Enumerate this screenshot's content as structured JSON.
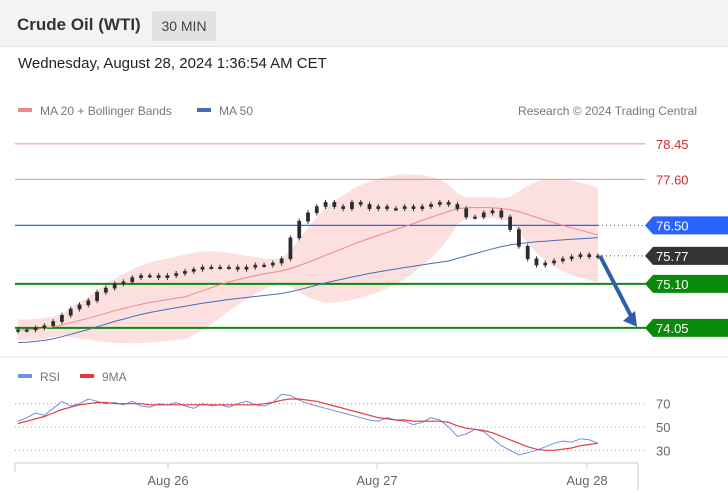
{
  "header": {
    "instrument": "Crude Oil (WTI)",
    "timeframe": "30 MIN",
    "datetime": "Wednesday, August 28, 2024 1:36:54 AM CET"
  },
  "legend": {
    "ma20": "MA 20 + Bollinger Bands",
    "ma50": "MA 50",
    "ma20_color": "#ef8a8a",
    "ma50_color": "#4a6cb2",
    "credit": "Research © 2024 Trading Central"
  },
  "rsi_legend": {
    "rsi": "RSI",
    "ma9": "9MA",
    "rsi_color": "#6f8fe0",
    "ma9_color": "#e23b3b"
  },
  "chart_data": [
    {
      "type": "line",
      "subtype": "candlestick",
      "x": [
        "Aug 26",
        "Aug 27",
        "Aug 28"
      ],
      "ylim": [
        73.4,
        78.9
      ],
      "price_series": [
        74.0,
        74.0,
        74.05,
        74.1,
        74.2,
        74.35,
        74.5,
        74.6,
        74.7,
        74.9,
        75.0,
        75.1,
        75.15,
        75.25,
        75.3,
        75.3,
        75.25,
        75.3,
        75.35,
        75.4,
        75.45,
        75.5,
        75.5,
        75.5,
        75.5,
        75.45,
        75.5,
        75.55,
        75.55,
        75.6,
        75.7,
        76.2,
        76.6,
        76.8,
        76.95,
        77.05,
        76.95,
        76.9,
        77.05,
        77.0,
        76.9,
        76.95,
        76.9,
        76.9,
        76.95,
        76.9,
        76.95,
        77.0,
        77.05,
        77.0,
        76.9,
        76.7,
        76.7,
        76.8,
        76.85,
        76.7,
        76.4,
        76.0,
        75.7,
        75.55,
        75.6,
        75.65,
        75.7,
        75.75,
        75.8,
        75.75,
        75.77
      ],
      "last_price": "75.77",
      "series": [
        {
          "name": "MA 20 + Bollinger Bands",
          "color": "#ef8a8a"
        },
        {
          "name": "MA 50",
          "color": "#4a6cb2"
        }
      ],
      "levels": [
        {
          "label": "78.45",
          "value": 78.45,
          "style": "resistance",
          "color": "#f08a8a"
        },
        {
          "label": "77.60",
          "value": 77.6,
          "style": "resistance",
          "color": "#f08a8a"
        },
        {
          "label": "76.50",
          "value": 76.5,
          "style": "pivot",
          "color": "#2962ff"
        },
        {
          "label": "75.77",
          "value": 75.77,
          "style": "last",
          "color": "#333333"
        },
        {
          "label": "75.10",
          "value": 75.1,
          "style": "support",
          "color": "#0a8a0a"
        },
        {
          "label": "74.05",
          "value": 74.05,
          "style": "target",
          "color": "#0a8a0a"
        }
      ],
      "forecast_arrow": {
        "from": 75.77,
        "to": 74.05,
        "color": "#2f5fa8"
      }
    },
    {
      "type": "line",
      "ylim": [
        20,
        80
      ],
      "levels": [
        70,
        50,
        30
      ],
      "level_labels": [
        "70",
        "50",
        "30"
      ],
      "series": [
        {
          "name": "RSI",
          "color": "#6f8fe0"
        },
        {
          "name": "9MA",
          "color": "#e23b3b"
        }
      ],
      "rsi_values": [
        55,
        58,
        62,
        60,
        66,
        72,
        68,
        70,
        74,
        72,
        70,
        71,
        69,
        72,
        68,
        67,
        70,
        69,
        71,
        68,
        66,
        70,
        68,
        69,
        67,
        70,
        72,
        69,
        68,
        71,
        78,
        77,
        73,
        70,
        68,
        66,
        64,
        62,
        60,
        58,
        56,
        55,
        58,
        56,
        55,
        52,
        54,
        58,
        56,
        50,
        42,
        44,
        48,
        46,
        40,
        34,
        30,
        26,
        28,
        30,
        33,
        36,
        38,
        37,
        40,
        39,
        36
      ],
      "ma9_values": [
        53,
        55,
        57,
        59,
        62,
        65,
        67,
        69,
        70,
        71,
        71,
        70,
        70,
        70,
        70,
        69,
        69,
        69,
        69,
        69,
        69,
        69,
        69,
        69,
        69,
        69,
        69,
        69,
        70,
        71,
        73,
        74,
        74,
        73,
        72,
        70,
        68,
        66,
        64,
        62,
        60,
        58,
        57,
        56,
        56,
        55,
        55,
        55,
        55,
        54,
        51,
        49,
        48,
        47,
        45,
        42,
        39,
        36,
        33,
        31,
        30,
        30,
        31,
        32,
        34,
        35,
        36
      ]
    }
  ],
  "x_axis": {
    "ticks": [
      "Aug 26",
      "Aug 27",
      "Aug 28"
    ]
  }
}
